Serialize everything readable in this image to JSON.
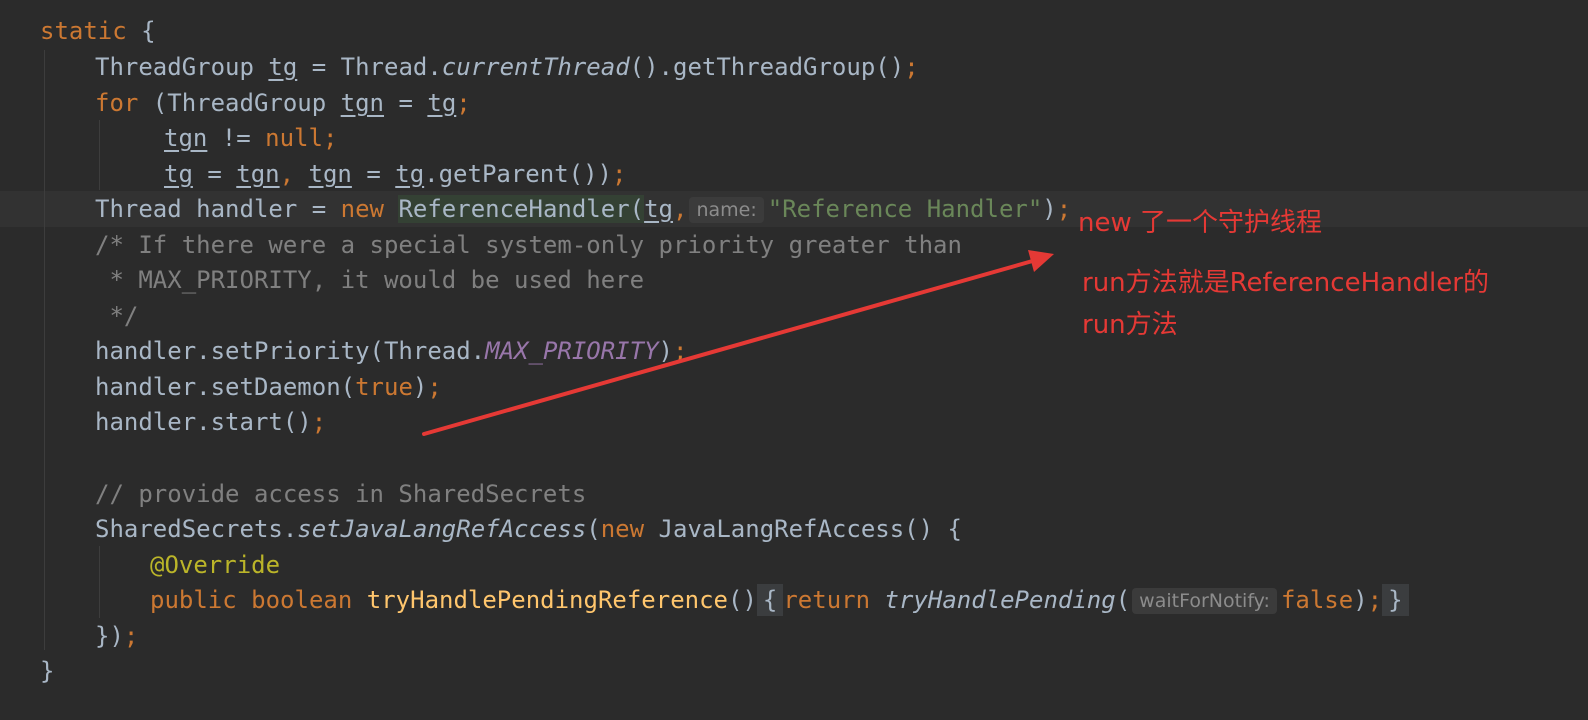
{
  "code": {
    "l1": {
      "kw": "static",
      "brace": " {"
    },
    "l2": {
      "type": "ThreadGroup ",
      "var": "tg",
      "eq": " = Thread.",
      "call": "currentThread",
      "rest": "().getThreadGroup()",
      "semi": ";"
    },
    "l3": {
      "kw": "for",
      "open": " (ThreadGroup ",
      "var": "tgn",
      "eq": " = ",
      "var2": "tg",
      "semi": ";"
    },
    "l4": {
      "var": "tgn",
      "op": " != ",
      "kw": "null",
      "semi": ";"
    },
    "l5": {
      "v1": "tg",
      "eq1": " = ",
      "v2": "tgn",
      "comma": ",",
      "sp": " ",
      "v3": "tgn",
      "eq2": " = ",
      "v4": "tg",
      "rest": ".getParent())",
      "semi": ";"
    },
    "l6": {
      "head": "Thread handler = ",
      "kw": "new",
      "sp": " ",
      "cls": "ReferenceHandler(",
      "var": "tg",
      "comma": ",",
      "hint": "name:",
      "str": "\"Reference Handler\"",
      "close": ")",
      "semi": ";"
    },
    "l7": "/* If there were a special system-only priority greater than",
    "l8": " * MAX_PRIORITY, it would be used here",
    "l9": " */",
    "l10": {
      "head": "handler.setPriority(Thread.",
      "const": "MAX_PRIORITY",
      "close": ")",
      "semi": ";"
    },
    "l11": {
      "head": "handler.setDaemon(",
      "kw": "true",
      "close": ")",
      "semi": ";"
    },
    "l12": {
      "head": "handler.start()",
      "semi": ";"
    },
    "l14": "// provide access in SharedSecrets",
    "l15": {
      "head": "SharedSecrets.",
      "call": "setJavaLangRefAccess",
      "open": "(",
      "kw": "new",
      "rest": " JavaLangRefAccess() {"
    },
    "l16": "@Override",
    "l17": {
      "kw1": "public",
      "sp1": " ",
      "kw2": "boolean",
      "sp2": " ",
      "fn": "tryHandlePendingReference",
      "parens": "()",
      "fold_open": "{",
      "kw3": "return",
      "sp3": " ",
      "call": "tryHandlePending",
      "open": "(",
      "hint": "waitForNotify:",
      "kw4": "false",
      "close": ")",
      "semi": ";",
      "fold_close": "}"
    },
    "l18": {
      "head": "})",
      "semi": ";"
    },
    "l19": "}"
  },
  "annotations": {
    "note1": "new 了一个守护线程",
    "note2_line1": "run方法就是ReferenceHandler的",
    "note2_line2": "run方法",
    "color": "#e53935"
  },
  "colors": {
    "background": "#2b2b2b",
    "keyword": "#cc7832",
    "string": "#6a8759",
    "comment": "#808080",
    "constant": "#9876aa",
    "annotation": "#bbb529",
    "method": "#ffc66d",
    "text": "#a9b7c6"
  }
}
